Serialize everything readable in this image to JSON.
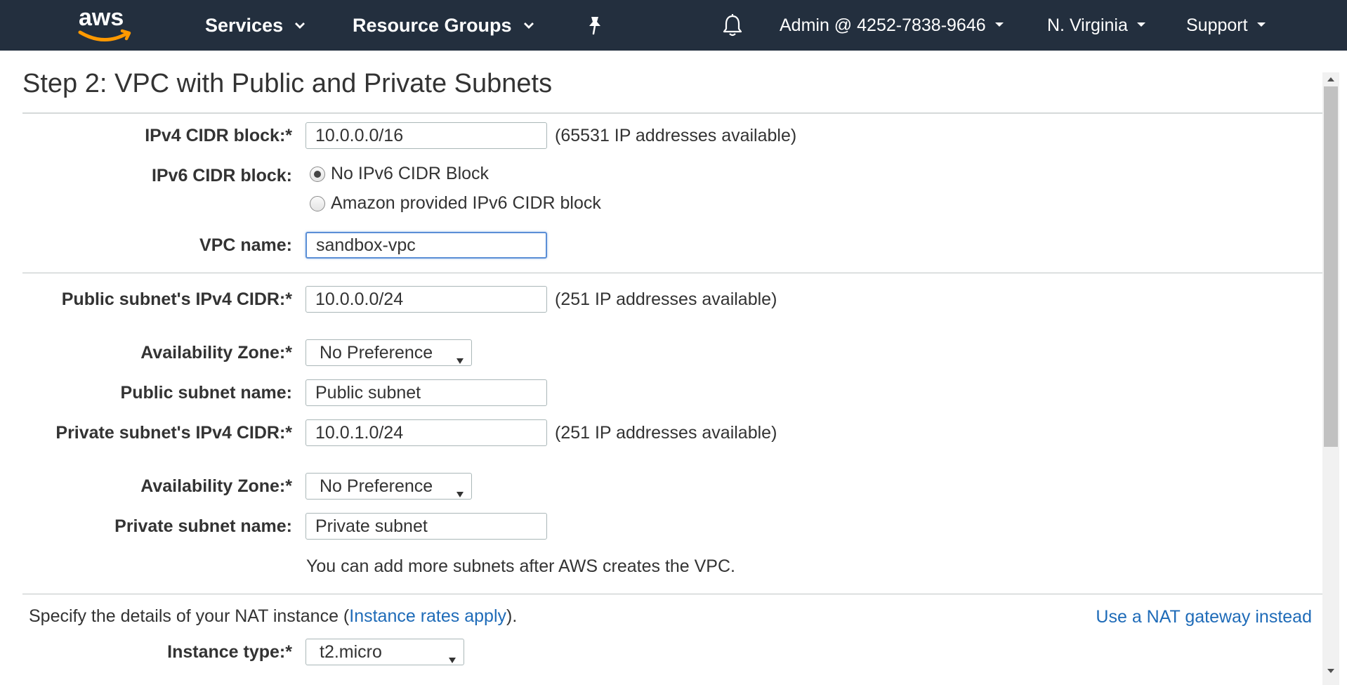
{
  "nav": {
    "logo_text": "aws",
    "services": "Services",
    "resource_groups": "Resource Groups",
    "account": "Admin @ 4252-7838-9646",
    "region": "N. Virginia",
    "support": "Support"
  },
  "page": {
    "title": "Step 2: VPC with Public and Private Subnets"
  },
  "form": {
    "ipv4_cidr": {
      "label": "IPv4 CIDR block:*",
      "value": "10.0.0.0/16",
      "note": "(65531 IP addresses available)"
    },
    "ipv6_cidr": {
      "label": "IPv6 CIDR block:",
      "options": [
        {
          "label": "No IPv6 CIDR Block",
          "checked": true
        },
        {
          "label": "Amazon provided IPv6 CIDR block",
          "checked": false
        }
      ]
    },
    "vpc_name": {
      "label": "VPC name:",
      "value": "sandbox-vpc"
    },
    "public_cidr": {
      "label": "Public subnet's IPv4 CIDR:*",
      "value": "10.0.0.0/24",
      "note": "(251 IP addresses available)"
    },
    "public_az": {
      "label": "Availability Zone:*",
      "value": "No Preference"
    },
    "public_name": {
      "label": "Public subnet name:",
      "value": "Public subnet"
    },
    "private_cidr": {
      "label": "Private subnet's IPv4 CIDR:*",
      "value": "10.0.1.0/24",
      "note": "(251 IP addresses available)"
    },
    "private_az": {
      "label": "Availability Zone:*",
      "value": "No Preference"
    },
    "private_name": {
      "label": "Private subnet name:",
      "value": "Private subnet"
    },
    "subnet_note": "You can add more subnets after AWS creates the VPC.",
    "nat": {
      "intro_prefix": "Specify the details of your NAT instance (",
      "intro_link": "Instance rates apply",
      "intro_suffix": ").",
      "gateway_link": "Use a NAT gateway instead",
      "instance_type_label": "Instance type:*",
      "instance_type_value": "t2.micro"
    }
  },
  "colors": {
    "nav_bg": "#232f3e",
    "link": "#1e6bb8",
    "focus": "#5b8fd6",
    "logo_smile": "#ff9900"
  }
}
